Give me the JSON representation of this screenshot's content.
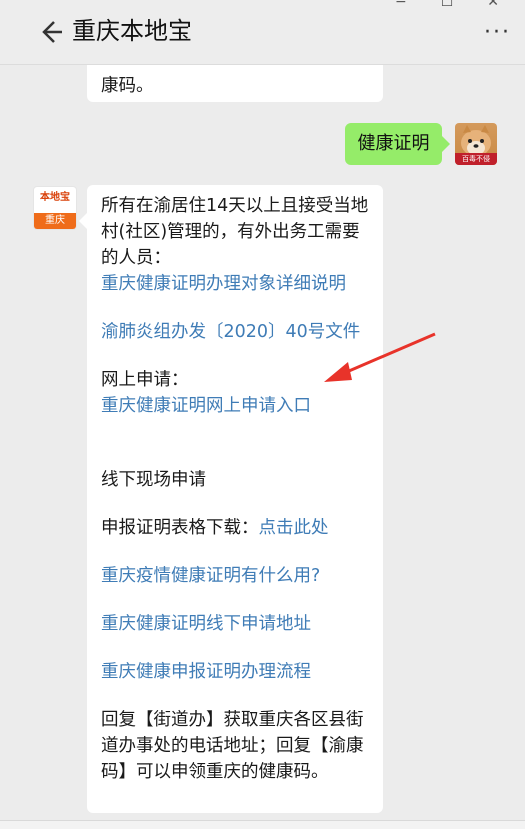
{
  "header": {
    "title": "重庆本地宝",
    "more": "···"
  },
  "window_controls": [
    "−",
    "☐",
    "✕"
  ],
  "top_bubble": {
    "text": "康码。"
  },
  "user_message": {
    "text": "健康证明"
  },
  "user_avatar": {
    "caption": "百毒不侵"
  },
  "bot_avatar": {
    "top": "本地宝",
    "bottom": "重庆"
  },
  "reply": {
    "intro": "所有在渝居住14天以上且接受当地村(社区)管理的，有外出务工需要的人员：",
    "link1": "重庆健康证明办理对象详细说明",
    "link2": "渝肺炎组办发〔2020〕40号文件",
    "online_label": "网上申请：",
    "link3": "重庆健康证明网上申请入口",
    "offline_label": "线下现场申请",
    "download_label": "申报证明表格下载：",
    "download_link": "点击此处",
    "link4": "重庆疫情健康证明有什么用?",
    "link5": "重庆健康证明线下申请地址",
    "link6": "重庆健康申报证明办理流程",
    "footer": "回复【街道办】获取重庆各区县街道办事处的电话地址；回复【渝康码】可以申领重庆的健康码。"
  },
  "colors": {
    "link": "#3f7cb6",
    "user_bubble": "#95ec69",
    "arrow": "#e8332a"
  }
}
